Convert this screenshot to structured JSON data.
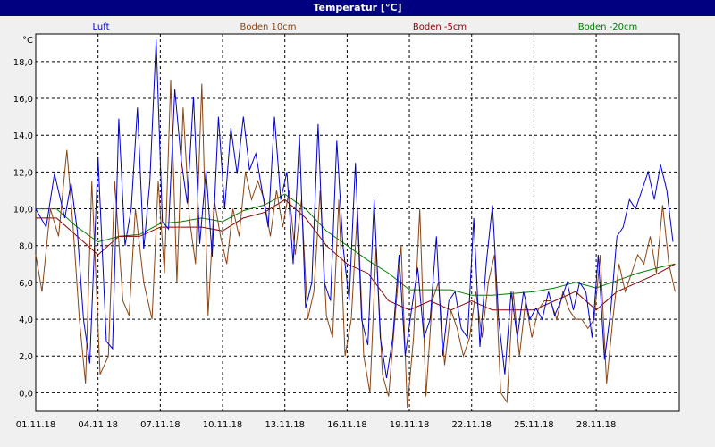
{
  "window": {
    "title": "Temperatur [°C]"
  },
  "chart_data": {
    "type": "line",
    "title": "Temperatur [°C]",
    "ylabel": "°C",
    "xlabel": "",
    "ylim": [
      -1.0,
      19.5
    ],
    "xlim": [
      0,
      31
    ],
    "grid": true,
    "legend": "top",
    "yticks": [
      "0,0",
      "2,0",
      "4,0",
      "6,0",
      "8,0",
      "10,0",
      "12,0",
      "14,0",
      "16,0",
      "18,0"
    ],
    "ytick_values": [
      0,
      2,
      4,
      6,
      8,
      10,
      12,
      14,
      16,
      18
    ],
    "xticks": [
      "01.11.18",
      "04.11.18",
      "07.11.18",
      "10.11.18",
      "13.11.18",
      "16.11.18",
      "19.11.18",
      "22.11.18",
      "25.11.18",
      "28.11.18"
    ],
    "xtick_days": [
      0,
      3,
      6,
      9,
      12,
      15,
      18,
      21,
      24,
      27
    ],
    "series": [
      {
        "name": "Luft",
        "color": "#0000cc",
        "x": [
          0,
          0.5,
          0.9,
          1.4,
          1.7,
          2.0,
          2.3,
          2.6,
          3.0,
          3.4,
          3.7,
          4.0,
          4.3,
          4.6,
          4.9,
          5.2,
          5.5,
          5.8,
          6.1,
          6.4,
          6.7,
          7.0,
          7.3,
          7.6,
          7.9,
          8.2,
          8.5,
          8.8,
          9.1,
          9.4,
          9.7,
          10.0,
          10.3,
          10.6,
          10.9,
          11.2,
          11.5,
          11.8,
          12.1,
          12.4,
          12.7,
          13.0,
          13.3,
          13.6,
          13.9,
          14.2,
          14.5,
          14.8,
          15.1,
          15.4,
          15.7,
          16.0,
          16.3,
          16.6,
          16.9,
          17.2,
          17.5,
          17.8,
          18.1,
          18.4,
          18.7,
          19.0,
          19.3,
          19.6,
          19.9,
          20.2,
          20.5,
          20.8,
          21.1,
          21.4,
          21.7,
          22.0,
          22.3,
          22.6,
          22.9,
          23.2,
          23.5,
          23.8,
          24.1,
          24.4,
          24.7,
          25.0,
          25.3,
          25.6,
          25.9,
          26.2,
          26.5,
          26.8,
          27.1,
          27.4,
          27.7,
          28.0,
          28.3,
          28.6,
          28.9,
          29.2,
          29.5,
          29.8,
          30.1,
          30.4,
          30.7
        ],
        "values": [
          10.0,
          9.0,
          11.9,
          9.5,
          11.4,
          8.8,
          4.0,
          1.6,
          12.8,
          2.8,
          2.4,
          14.9,
          8.0,
          10.0,
          15.5,
          7.8,
          11.5,
          19.2,
          9.3,
          8.9,
          16.5,
          12.7,
          10.3,
          16.1,
          8.1,
          12.1,
          7.4,
          15.0,
          10.0,
          14.4,
          11.9,
          15.0,
          12.1,
          13.0,
          11.0,
          9.0,
          15.0,
          10.5,
          12.0,
          7.0,
          14.0,
          4.6,
          6.0,
          14.6,
          6.0,
          5.0,
          13.7,
          8.0,
          5.0,
          12.5,
          4.0,
          2.6,
          10.5,
          3.0,
          0.8,
          3.0,
          7.5,
          2.0,
          4.5,
          6.8,
          3.0,
          4.0,
          8.5,
          2.0,
          5.0,
          5.5,
          3.5,
          3.0,
          9.5,
          2.5,
          7.0,
          10.2,
          4.0,
          1.0,
          5.5,
          3.0,
          5.5,
          4.0,
          4.6,
          4.0,
          5.5,
          4.2,
          5.0,
          6.0,
          4.5,
          6.0,
          5.5,
          3.0,
          7.5,
          1.8,
          4.5,
          8.5,
          9.0,
          10.5,
          10.0,
          11.0,
          12.0,
          10.5,
          12.4,
          11.0,
          8.2
        ]
      },
      {
        "name": "Boden 10cm",
        "color": "#8b4513",
        "x": [
          0,
          0.3,
          0.7,
          1.1,
          1.5,
          1.8,
          2.1,
          2.4,
          2.7,
          3.1,
          3.5,
          3.8,
          4.2,
          4.5,
          4.8,
          5.2,
          5.6,
          5.9,
          6.2,
          6.5,
          6.8,
          7.1,
          7.4,
          7.7,
          8.0,
          8.3,
          8.6,
          8.9,
          9.2,
          9.5,
          9.8,
          10.1,
          10.4,
          10.7,
          11.0,
          11.3,
          11.6,
          11.9,
          12.2,
          12.5,
          12.8,
          13.1,
          13.4,
          13.7,
          14.0,
          14.3,
          14.6,
          14.9,
          15.2,
          15.5,
          15.8,
          16.1,
          16.4,
          16.7,
          17.0,
          17.3,
          17.6,
          17.9,
          18.2,
          18.5,
          18.8,
          19.1,
          19.4,
          19.7,
          20.0,
          20.3,
          20.6,
          20.9,
          21.2,
          21.5,
          21.8,
          22.1,
          22.4,
          22.7,
          23.0,
          23.3,
          23.6,
          23.9,
          24.2,
          24.5,
          24.8,
          25.1,
          25.4,
          25.7,
          26.0,
          26.3,
          26.6,
          26.9,
          27.2,
          27.5,
          27.8,
          28.1,
          28.4,
          28.7,
          29.0,
          29.3,
          29.6,
          29.9,
          30.2,
          30.5,
          30.8
        ],
        "values": [
          7.5,
          5.5,
          10.0,
          8.5,
          13.2,
          9.0,
          4.0,
          0.5,
          11.5,
          1.0,
          2.0,
          11.5,
          5.0,
          4.2,
          10.0,
          6.0,
          4.0,
          11.5,
          6.5,
          17.0,
          6.0,
          15.5,
          9.5,
          7.0,
          16.8,
          4.2,
          10.5,
          8.5,
          7.0,
          10.0,
          8.5,
          12.0,
          10.5,
          11.5,
          10.5,
          8.5,
          11.0,
          9.0,
          11.0,
          7.5,
          10.5,
          4.0,
          5.5,
          11.0,
          4.2,
          3.0,
          10.5,
          2.0,
          4.0,
          10.0,
          2.0,
          0.0,
          8.0,
          1.0,
          -0.2,
          4.0,
          8.0,
          -0.8,
          3.0,
          10.0,
          -0.2,
          5.0,
          6.0,
          1.5,
          4.5,
          3.5,
          2.0,
          3.0,
          5.5,
          3.0,
          6.0,
          7.5,
          0.0,
          -0.5,
          5.5,
          2.0,
          5.0,
          3.0,
          4.5,
          5.0,
          5.0,
          4.0,
          5.5,
          4.5,
          4.0,
          4.0,
          3.5,
          4.0,
          7.5,
          0.5,
          4.0,
          7.0,
          5.5,
          6.5,
          7.5,
          7.0,
          8.5,
          6.5,
          10.2,
          7.0,
          5.5
        ]
      },
      {
        "name": "Boden -5cm",
        "color": "#8b0000",
        "x": [
          0,
          1,
          2,
          3,
          4,
          5,
          6,
          7,
          8,
          9,
          10,
          11,
          12,
          13,
          14,
          15,
          16,
          17,
          18,
          19,
          20,
          21,
          22,
          23,
          24,
          25,
          26,
          27,
          28,
          29,
          30,
          30.8
        ],
        "values": [
          9.5,
          9.5,
          8.5,
          7.5,
          8.5,
          8.5,
          9.0,
          9.0,
          9.0,
          8.8,
          9.5,
          9.8,
          10.5,
          9.5,
          8.0,
          7.0,
          6.5,
          5.0,
          4.5,
          5.0,
          4.5,
          5.0,
          4.5,
          4.5,
          4.5,
          5.0,
          5.5,
          4.5,
          5.5,
          6.0,
          6.5,
          7.0
        ]
      },
      {
        "name": "Boden -20cm",
        "color": "#008000",
        "x": [
          0,
          1,
          2,
          3,
          4,
          5,
          6,
          7,
          8,
          9,
          10,
          11,
          12,
          13,
          14,
          15,
          16,
          17,
          18,
          19,
          20,
          21,
          22,
          23,
          24,
          25,
          26,
          27,
          28,
          29,
          30,
          30.8
        ],
        "values": [
          10.0,
          10.0,
          9.0,
          8.2,
          8.5,
          8.6,
          9.2,
          9.3,
          9.5,
          9.3,
          9.9,
          10.2,
          10.8,
          10.0,
          8.8,
          8.0,
          7.2,
          6.5,
          5.6,
          5.6,
          5.6,
          5.3,
          5.3,
          5.4,
          5.5,
          5.7,
          6.0,
          5.7,
          6.1,
          6.5,
          6.8,
          7.0
        ]
      }
    ]
  }
}
